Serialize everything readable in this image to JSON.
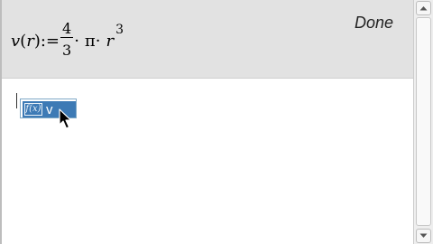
{
  "history": {
    "expression": {
      "func": "v",
      "arg": "r",
      "assign": ":=",
      "numerator": "4",
      "denominator": "3",
      "dot": "·",
      "pi": "π",
      "var": "r",
      "exponent": "3"
    },
    "result": "Done"
  },
  "entry": {
    "suggestion": {
      "icon": "f(x)",
      "label": "v"
    }
  },
  "icons": {
    "suggestion": "function-icon",
    "pointer": "mouse-pointer-icon",
    "scroll_up": "scroll-up-arrow-icon",
    "scroll_down": "scroll-down-arrow-icon"
  },
  "colors": {
    "history_bg": "#e2e2e2",
    "selection": "#3d7ab5",
    "scrollbar": "#eeeeee"
  }
}
